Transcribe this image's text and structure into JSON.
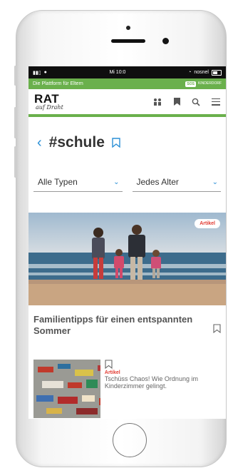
{
  "status_bar": {
    "carrier": "nosnel",
    "time": "Mi 10:0"
  },
  "top_banner": {
    "tagline": "Die Plattform für Eltern",
    "partner_logo": "SOS",
    "partner_text": "KINDERDORF"
  },
  "brand": {
    "name": "RAT",
    "subtitle": "auf Draht"
  },
  "header_icons": [
    "people-icon",
    "bookmark-icon",
    "search-icon",
    "menu-icon"
  ],
  "page": {
    "tag_title": "#schule"
  },
  "filters": [
    {
      "label": "Alle Typen"
    },
    {
      "label": "Jedes Alter"
    }
  ],
  "featured_article": {
    "badge": "Artikel",
    "title": "Familientipps für einen entspannten Sommer"
  },
  "second_article": {
    "category": "Artikel",
    "title": "Tschüss Chaos! Wie Ordnung im Kinderzimmer gelingt."
  },
  "colors": {
    "accent_green": "#6ab04c",
    "link_blue": "#2a8fd6",
    "badge_red": "#e23b32"
  }
}
